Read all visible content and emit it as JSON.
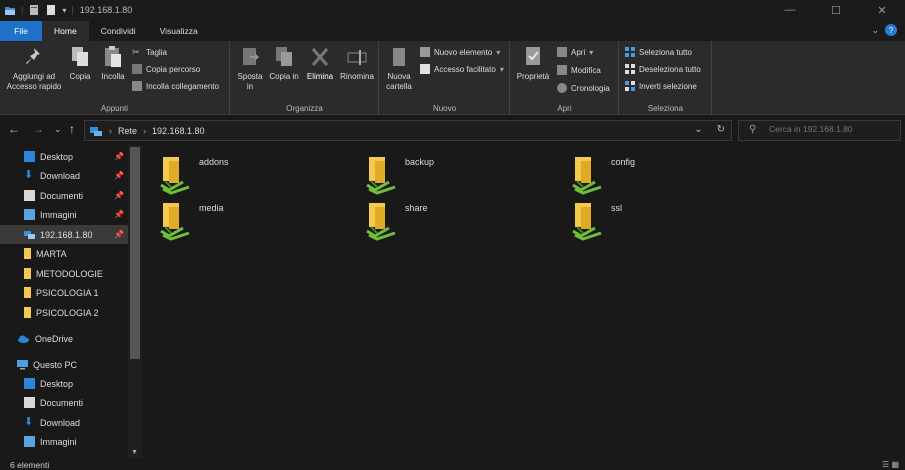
{
  "window": {
    "title": "192.168.1.80",
    "controls": [
      "—",
      "☐",
      "✕"
    ]
  },
  "ribbon_tabs": [
    "File",
    "Home",
    "Condividi",
    "Visualizza"
  ],
  "ribbon": {
    "appunti": {
      "label": "Appunti",
      "pin": "Aggiungi ad Accesso rapido",
      "copy": "Copia",
      "paste": "Incolla",
      "cut": "Taglia",
      "copy_path": "Copia percorso",
      "paste_link": "Incolla collegamento"
    },
    "organizza": {
      "label": "Organizza",
      "move": "Sposta in",
      "copyto": "Copia in",
      "delete": "Elimina",
      "rename": "Rinomina"
    },
    "nuovo": {
      "label": "Nuovo",
      "new_folder": "Nuova cartella",
      "new_item": "Nuovo elemento",
      "easy_access": "Accesso facilitato"
    },
    "apri": {
      "label": "Apri",
      "properties": "Proprietà",
      "open": "Apri",
      "edit": "Modifica",
      "history": "Cronologia"
    },
    "seleziona": {
      "label": "Seleziona",
      "select_all": "Seleziona tutto",
      "select_none": "Deseleziona tutto",
      "invert": "Inverti selezione"
    }
  },
  "address": {
    "segments": [
      "Rete",
      "192.168.1.80"
    ],
    "search_placeholder": "Cerca in 192.168.1.80"
  },
  "sidebar": {
    "items": [
      {
        "label": "Desktop",
        "icon": "desktop-icon",
        "pinned": true
      },
      {
        "label": "Download",
        "icon": "download-icon",
        "pinned": true
      },
      {
        "label": "Documenti",
        "icon": "documents-icon",
        "pinned": true
      },
      {
        "label": "Immagini",
        "icon": "pictures-icon",
        "pinned": true
      },
      {
        "label": "192.168.1.80",
        "icon": "network-drive-icon",
        "pinned": true,
        "selected": true
      },
      {
        "label": "MARTA",
        "icon": "folder-icon"
      },
      {
        "label": "METODOLOGIE",
        "icon": "folder-icon"
      },
      {
        "label": "PSICOLOGIA 1",
        "icon": "folder-icon"
      },
      {
        "label": "PSICOLOGIA 2",
        "icon": "folder-icon"
      },
      {
        "label": "OneDrive",
        "icon": "onedrive-icon"
      },
      {
        "label": "Questo PC",
        "icon": "pc-icon"
      },
      {
        "label": "Desktop",
        "icon": "desktop-icon"
      },
      {
        "label": "Documenti",
        "icon": "documents-icon"
      },
      {
        "label": "Download",
        "icon": "download-icon"
      },
      {
        "label": "Immagini",
        "icon": "pictures-icon"
      }
    ]
  },
  "folders": [
    "addons",
    "backup",
    "config",
    "media",
    "share",
    "ssl"
  ],
  "status": {
    "count": "6 elementi"
  },
  "colors": {
    "accent": "#1e70c8",
    "folder": "#f3c94f",
    "share_green": "#6fbf3a"
  }
}
